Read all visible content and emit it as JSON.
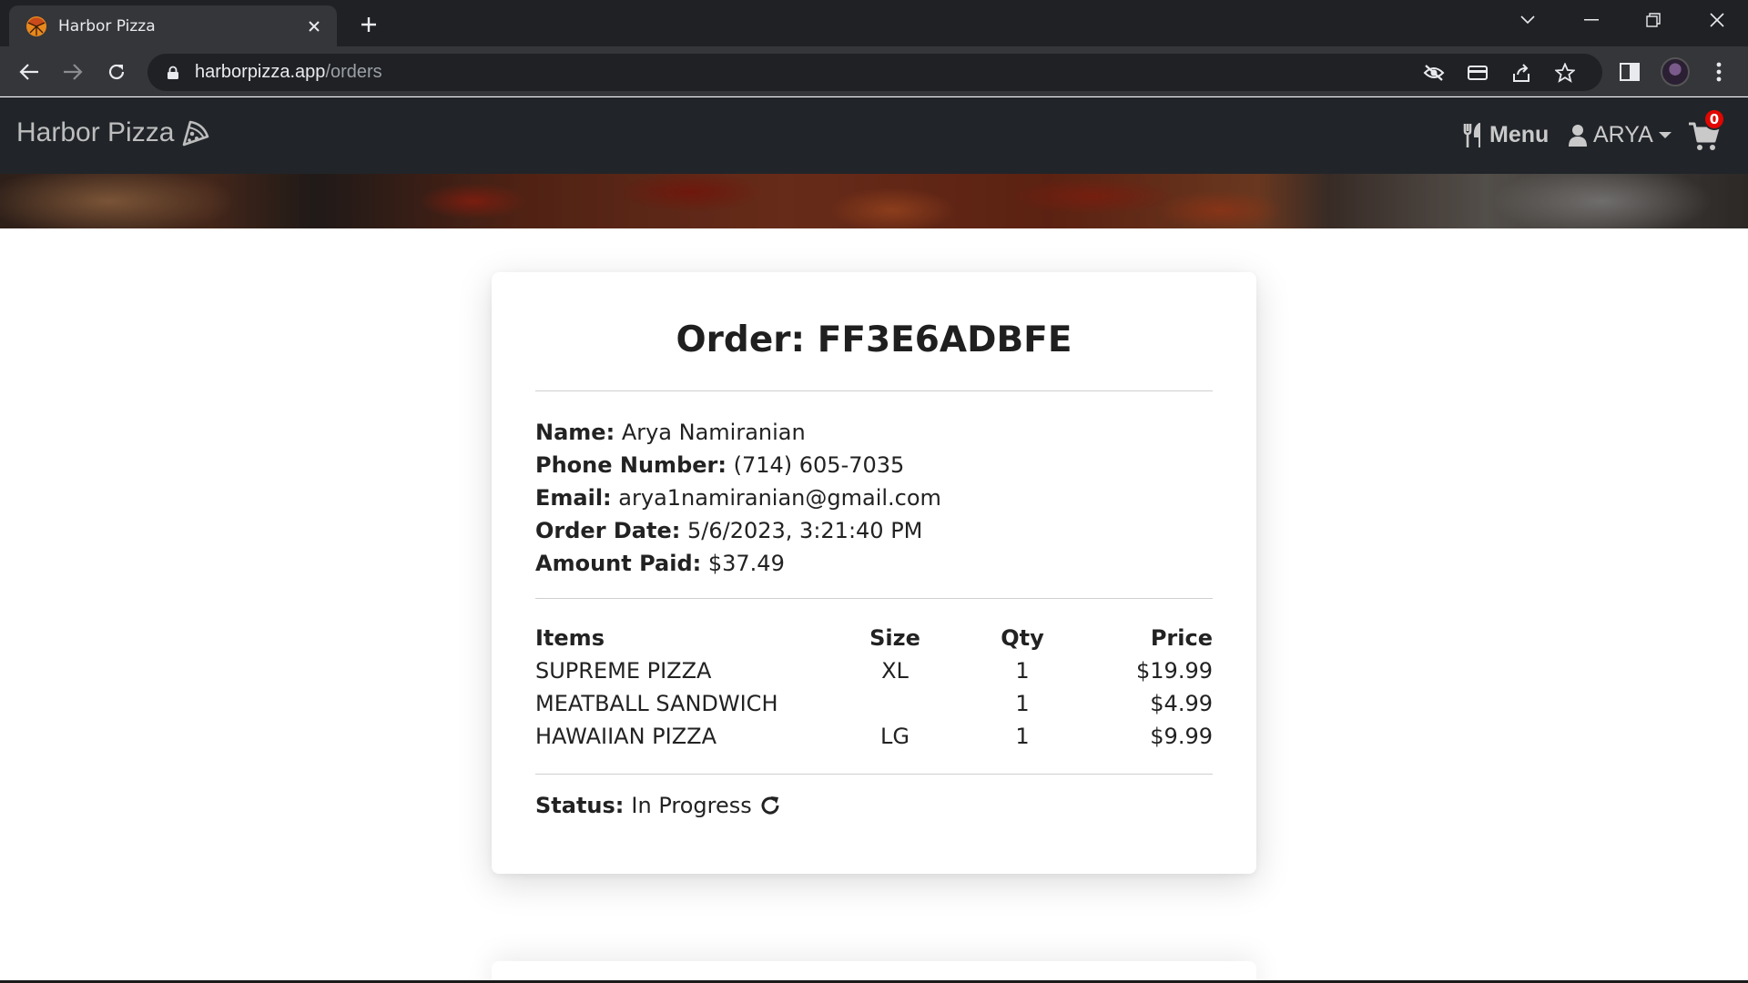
{
  "browser": {
    "tab_title": "Harbor Pizza",
    "url_host": "harborpizza.app",
    "url_path": "/orders"
  },
  "site": {
    "brand": "Harbor Pizza",
    "nav_menu_label": "Menu",
    "nav_user_label": "ARYA",
    "cart_count": "0",
    "accent_color": "#e10600"
  },
  "order": {
    "title": "Order: FF3E6ADBFE",
    "fields": [
      {
        "label": "Name:",
        "value": "Arya Namiranian"
      },
      {
        "label": "Phone Number:",
        "value": "(714) 605-7035"
      },
      {
        "label": "Email:",
        "value": "arya1namiranian@gmail.com"
      },
      {
        "label": "Order Date:",
        "value": "5/6/2023, 3:21:40 PM"
      },
      {
        "label": "Amount Paid:",
        "value": "$37.49"
      }
    ],
    "columns": {
      "item": "Items",
      "size": "Size",
      "qty": "Qty",
      "price": "Price"
    },
    "items": [
      {
        "name": "SUPREME PIZZA",
        "size": "XL",
        "qty": "1",
        "price": "$19.99"
      },
      {
        "name": "MEATBALL SANDWICH",
        "size": "",
        "qty": "1",
        "price": "$4.99"
      },
      {
        "name": "HAWAIIAN PIZZA",
        "size": "LG",
        "qty": "1",
        "price": "$9.99"
      }
    ],
    "status_label": "Status:",
    "status_value": "In Progress",
    "status_icon": "redo-arrow-icon"
  }
}
